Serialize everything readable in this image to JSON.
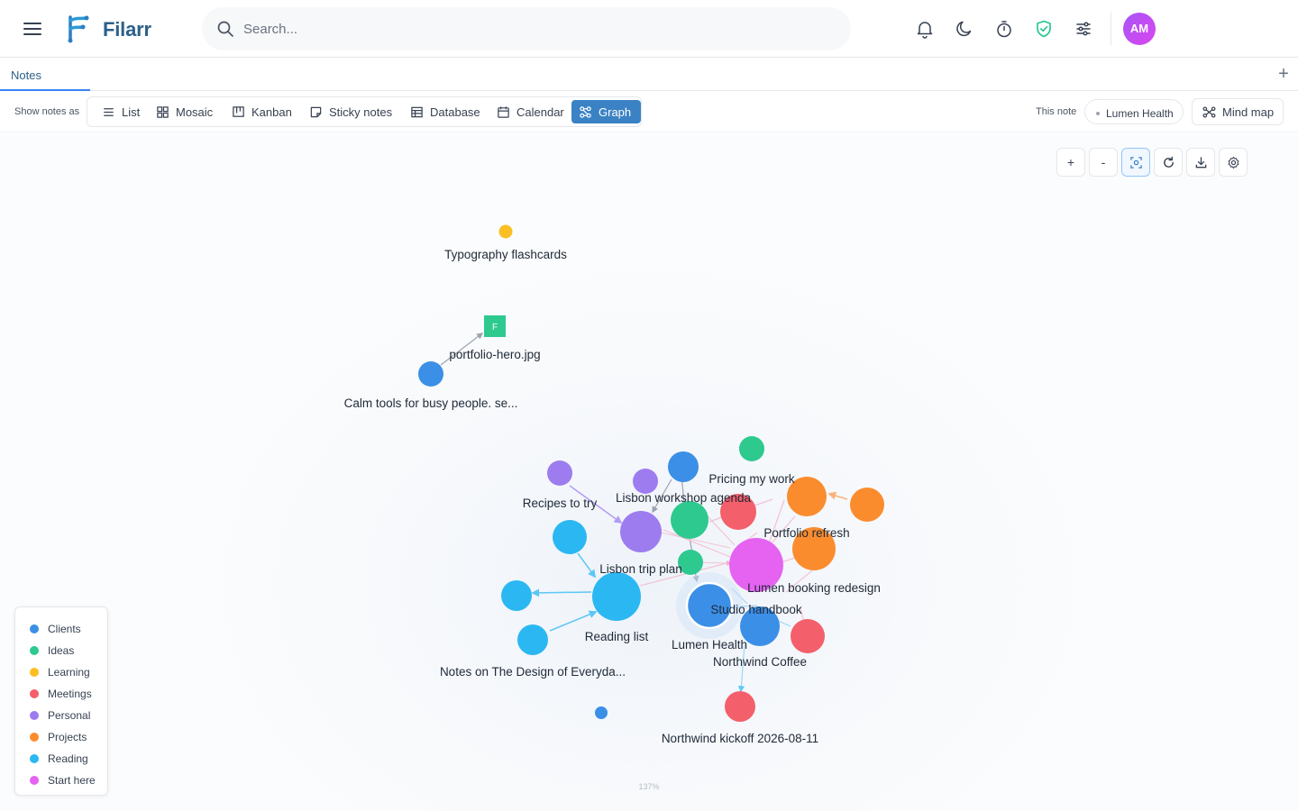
{
  "app": {
    "brand": "Filarr",
    "user_initials": "AM"
  },
  "search": {
    "placeholder": "Search..."
  },
  "toolbar_icons": [
    "bell-icon",
    "moon-icon",
    "timer-icon",
    "shield-check-icon",
    "sliders-icon"
  ],
  "tabs": [
    {
      "label": "Notes",
      "active": true
    }
  ],
  "viewbar": {
    "show_label": "Show notes as",
    "views": [
      {
        "label": "List",
        "icon": "list-icon"
      },
      {
        "label": "Mosaic",
        "icon": "mosaic-icon"
      },
      {
        "label": "Kanban",
        "icon": "kanban-icon"
      },
      {
        "label": "Sticky notes",
        "icon": "sticky-note-icon"
      },
      {
        "label": "Database",
        "icon": "table-icon"
      },
      {
        "label": "Calendar",
        "icon": "calendar-icon"
      },
      {
        "label": "Graph",
        "icon": "graph-icon",
        "active": true
      }
    ],
    "this_note_label": "This note",
    "current_note": "Lumen Health",
    "mind_map_label": "Mind map"
  },
  "graph_controls": {
    "zoom_in": "+",
    "zoom_out": "-",
    "icons": [
      "fit-view-icon",
      "refresh-icon",
      "download-icon",
      "settings-icon"
    ]
  },
  "legend": [
    {
      "label": "Clients",
      "color": "#3b8fe6"
    },
    {
      "label": "Ideas",
      "color": "#2ec98f"
    },
    {
      "label": "Learning",
      "color": "#fbbf24"
    },
    {
      "label": "Meetings",
      "color": "#f35f6a"
    },
    {
      "label": "Personal",
      "color": "#9d7cf0"
    },
    {
      "label": "Projects",
      "color": "#fb8c2e"
    },
    {
      "label": "Reading",
      "color": "#2bb8f2"
    },
    {
      "label": "Start here",
      "color": "#e563f0"
    }
  ],
  "graph": {
    "zoom_level": "137%",
    "file_badge": "F",
    "labels": {
      "typography": "Typography flashcards",
      "portfolio_hero": "portfolio-hero.jpg",
      "calm_tools": "Calm tools for busy people. se...",
      "recipes": "Recipes to try",
      "lisbon_workshop": "Lisbon workshop agenda",
      "pricing": "Pricing my work",
      "portfolio_refresh": "Portfolio refresh",
      "lisbon_trip": "Lisbon trip plan",
      "lumen_booking": "Lumen booking redesign",
      "studio_handbook": "Studio handbook",
      "reading_list": "Reading list",
      "lumen_health": "Lumen Health",
      "northwind_coffee": "Northwind Coffee",
      "design_everyday": "Notes on The Design of Everyda...",
      "northwind_kickoff": "Northwind kickoff 2026-08-11"
    }
  }
}
